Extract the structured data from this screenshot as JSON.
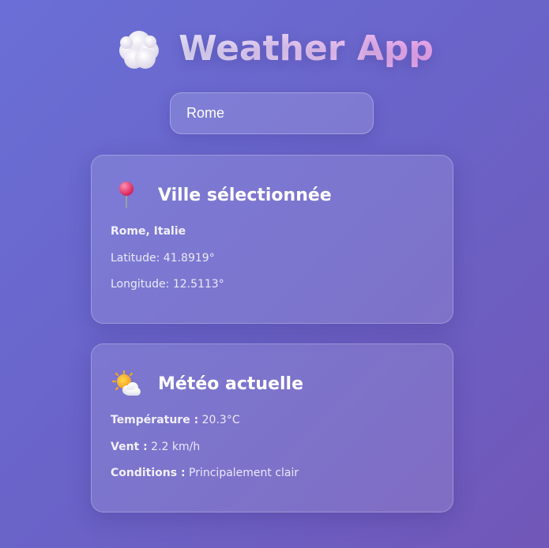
{
  "header": {
    "title": "Weather App",
    "icon": "cloud-icon"
  },
  "search": {
    "value": "Rome",
    "placeholder": ""
  },
  "city_card": {
    "icon": "pushpin-icon",
    "title": "Ville sélectionnée",
    "name": "Rome, Italie",
    "latitude_label": "Latitude:",
    "latitude_value": "41.8919°",
    "longitude_label": "Longitude:",
    "longitude_value": "12.5113°"
  },
  "weather_card": {
    "icon": "sun-behind-cloud-icon",
    "title": "Météo actuelle",
    "temperature_label": "Température :",
    "temperature_value": "20.3°C",
    "wind_label": "Vent :",
    "wind_value": "2.2 km/h",
    "conditions_label": "Conditions :",
    "conditions_value": "Principalement clair"
  },
  "colors": {
    "background_start": "#6a6fd6",
    "background_end": "#7157b8",
    "title_gradient_start": "#e8e6fb",
    "title_gradient_end": "#f0a8ee",
    "pin_red": "#e0245e",
    "sun_orange": "#f4a623"
  }
}
